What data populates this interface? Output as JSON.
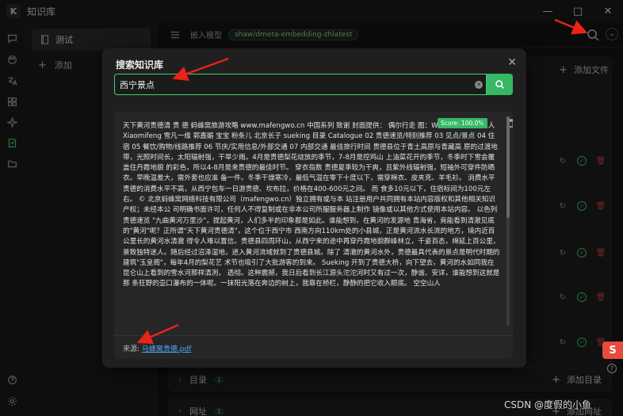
{
  "app": {
    "title": "知识库",
    "logo_glyph": "K"
  },
  "window_buttons": {
    "minimize": "—",
    "maximize": "□",
    "close": "✕"
  },
  "rail": {
    "icons": [
      "chat-icon",
      "palette-icon",
      "translate-icon",
      "apps-icon",
      "sparkle-icon",
      "knowledge-icon",
      "folder-icon",
      "help-icon",
      "settings-icon"
    ],
    "active": "knowledge-icon"
  },
  "kb_list": {
    "items": [
      {
        "label": "测试"
      }
    ],
    "add_label": "添加"
  },
  "topbar": {
    "label": "嵌入模型",
    "model": "shaw/dmeta-embedding-zhlatest"
  },
  "sections": {
    "file_add_label": "添加文件",
    "directory": {
      "label": "目录",
      "count": "1",
      "add_label": "添加目录"
    },
    "url": {
      "label": "网址",
      "count": "1",
      "add_label": "添加网址"
    }
  },
  "modal": {
    "title": "搜索知识库",
    "close_glyph": "✕",
    "search_value": "西宁景点",
    "result": {
      "score": "Score: 100.0%",
      "body": "天下黄河贵德清 贵 德 蚂蜂窝旅游攻略 www.mafengwo.cn 中国系列 致谢 封面提供： 偶尔行走 图：Wolfatwar 空空山人 Xiaomifeng 雪凡一缘 郭嘉媚 宝宝 粉条儿 北京长子 sueking 目录 Catalogue 02 贵德速览/特别推荐 03 见点/景点 04 住宿 05 餐饮/购物/线路推荐 06 节庆/实用信息/外部交通 07 内部交通 最佳旅行时间 贵德县位于青土高原与青藏高 原的过渡地带，光照时间长，太阳辐射强，干旱少雨。4月是贵德梨花绽放的季节，7-8月是控鸡山 上油菜花开的季节，冬季时下雪会覆盖住丹霞地貌 的彩色，所以4-8月是来贵德的最佳时节。 穿衣指数 贵德夏季较为干爽，且紫外线辐射强，短袖外可穿件防晒衣。早晚温差大，需外套也应准 备一件。冬季干燥寒冷，最低气温在零下十度以下，需穿棉衣、皮夹克、羊毛衫。 消费水平 贵德的消费水平不高，从西宁包车一日游贵德、坎布拉，价格在400-600元之间。 而 食多10元以下，住宿标间为100元左右。 © 北京蚂蜂窝网络科技有限公司（mafengwo.cn）独立拥有或与本 站注册用户共同拥有本站内容版权和其他相关知识产权；未经本公 司明确书面许可，任何人不得复制或在非本公司所服服务器上制作 镜像或以其他方式使用本站内容。 以色列 贵德速览 \"九曲黄河万里沙\"，提起黄河，人们多半的印象都是如此。谁能想到，在黄河的发源地 青海省，竟能看到清澈见底的\"黄河\"呢？正所谓\"天下黄河贵德清\"，这个位于西宁市 西南方向110km处的小县城，正是黄河流水长流的地方，境内近百公里长的黄河水清澈 得令人难以置信。贵德县四周环山，从西宁来的途中再穿丹霞地貌群峰林立，千姿百态，绵延上百公里，景致独特迷人。随后经过沼泽湿地，进入黄河流域就到了贵德县城。除了 清澈的黄河水外，贵德最具代表的景点是明代时期的建筑\"玉皇阁\"，每年4月的梨花艺 术节也吸引了大批游客的到来。 Sueking 开到了贵德大桥，向下望去，黄河的水如同我在昆仑山上看到的雪水河那样清冽， 透彻。这种震撼，我日后看到长江源头沱沱河时又有过一次，静谧、安详，谁能想到这就是那 条狂野的壶口瀑布的一体呢。一抹阳光落在奔边的树上，我靠在桥栏，静静的把它收入眼底。 空空山人",
      "source_label": "来源:",
      "source_file": "马蜂窝贵德.pdf"
    }
  },
  "watermark": "CSDN @度假的小鱼",
  "ime_glyph": "S",
  "colors": {
    "accent": "#36b866",
    "danger": "#d04545",
    "link": "#4ea6ff",
    "annotation": "#e8231a"
  }
}
